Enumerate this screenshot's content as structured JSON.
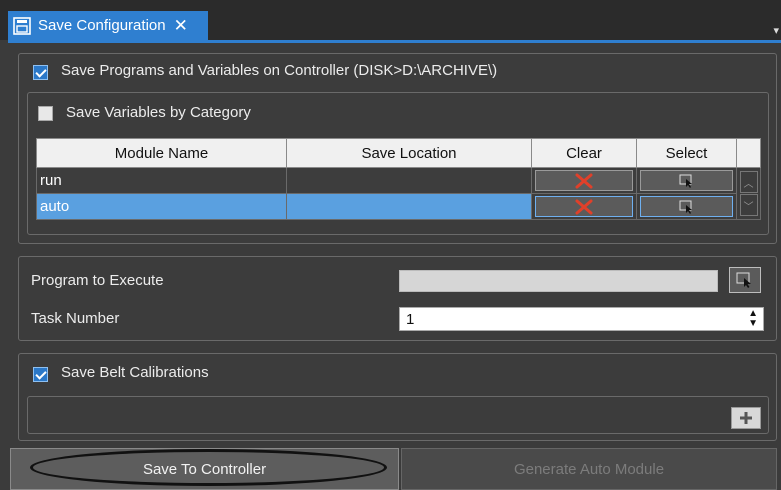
{
  "tab": {
    "title": "Save Configuration",
    "close": "✕",
    "icon": "document-icon"
  },
  "save_programs": {
    "checked": true,
    "label": "Save Programs and Variables on Controller (DISK>D:\\ARCHIVE\\)"
  },
  "save_by_category": {
    "checked": false,
    "label": "Save Variables by Category"
  },
  "table": {
    "columns": [
      "Module Name",
      "Save Location",
      "Clear",
      "Select"
    ],
    "rows": [
      {
        "name": "run",
        "location": "",
        "selected": false
      },
      {
        "name": "auto",
        "location": "",
        "selected": true
      }
    ]
  },
  "program_to_execute": {
    "label": "Program to Execute",
    "value": ""
  },
  "task_number": {
    "label": "Task Number",
    "value": "1"
  },
  "save_belt": {
    "checked": true,
    "label": "Save Belt Calibrations"
  },
  "buttons": {
    "save_to_controller": "Save To Controller",
    "generate_auto_module": "Generate Auto Module"
  },
  "colors": {
    "accent": "#2f7fd0",
    "selected_row": "#5aa0e0",
    "clear_x": "#e0402a"
  }
}
